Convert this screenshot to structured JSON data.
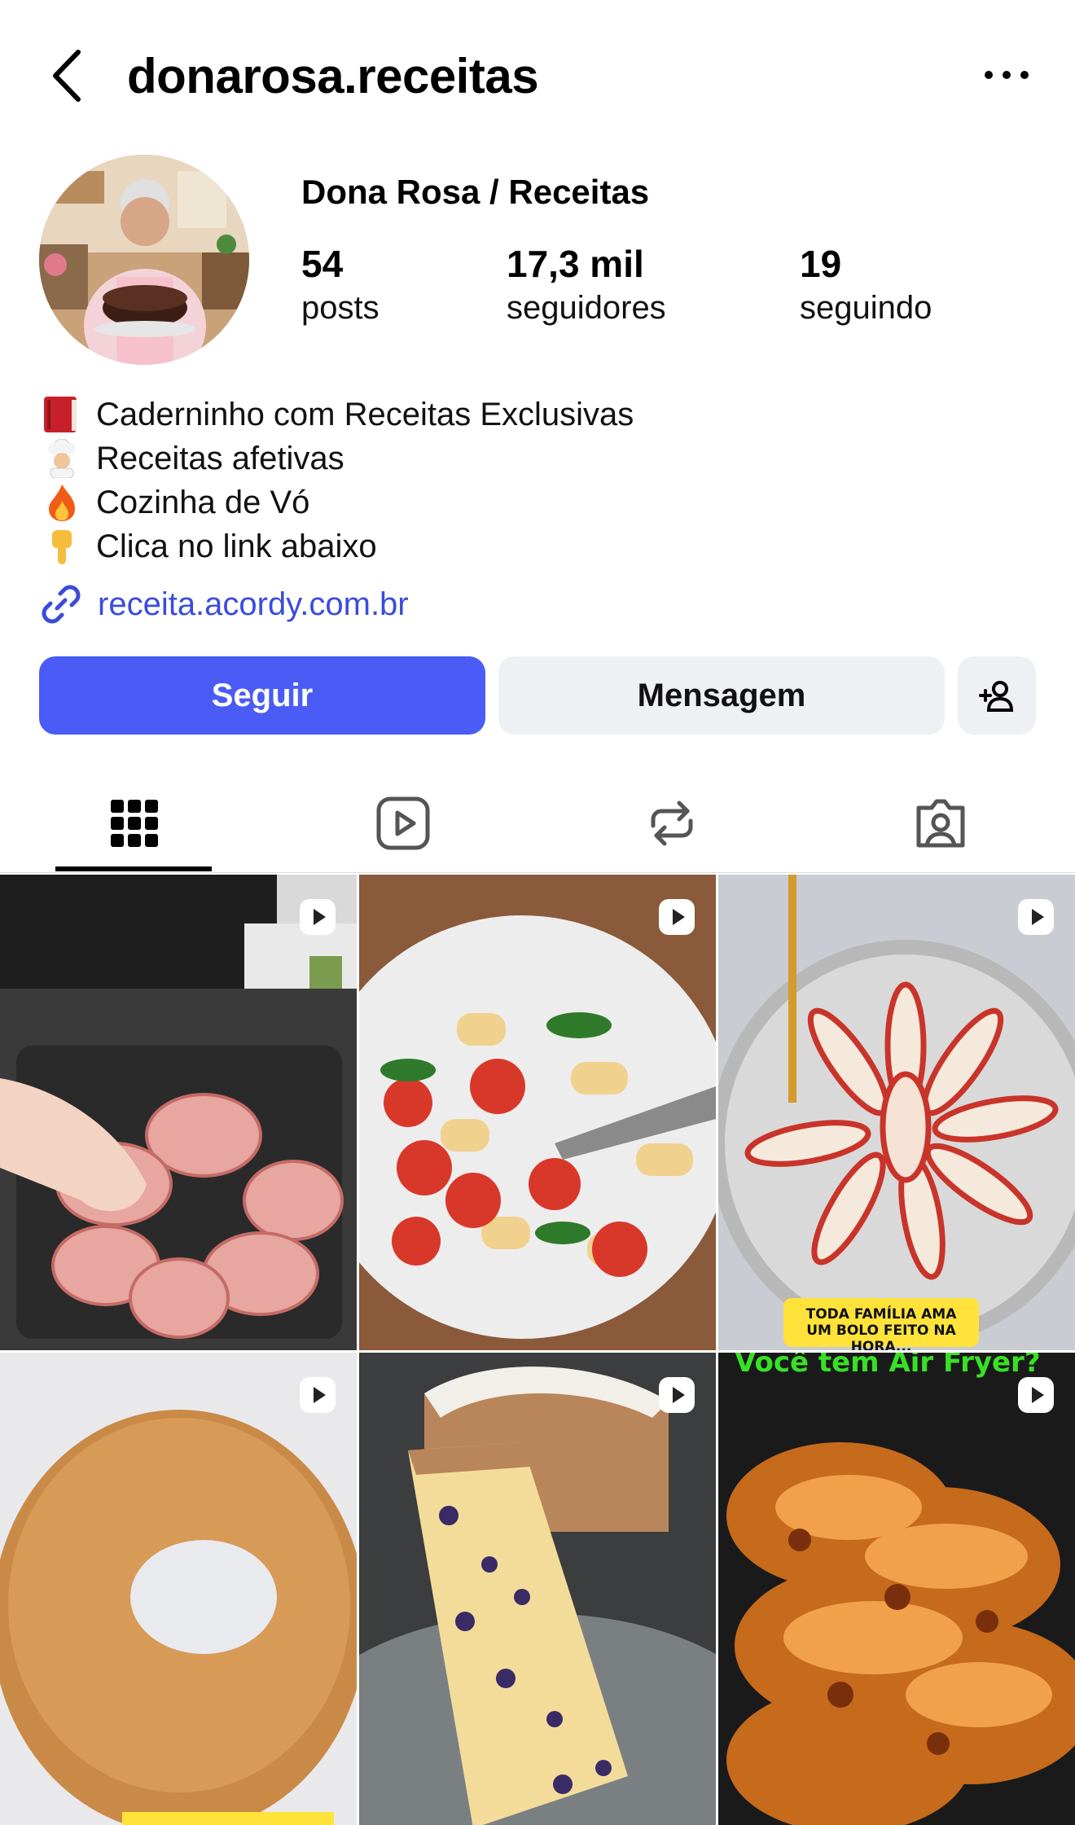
{
  "header": {
    "username": "donarosa.receitas",
    "back_icon": "chevron-left-icon",
    "more_icon": "ellipsis-icon"
  },
  "profile": {
    "display_name": "Dona Rosa / Receitas",
    "stats": [
      {
        "value": "54",
        "label": "posts"
      },
      {
        "value": "17,3 mil",
        "label": "seguidores"
      },
      {
        "value": "19",
        "label": "seguindo"
      }
    ],
    "bio": [
      {
        "emoji": "red-book-icon",
        "text": "Caderninho com Receitas Exclusivas"
      },
      {
        "emoji": "chef-icon",
        "text": "Receitas afetivas"
      },
      {
        "emoji": "fire-icon",
        "text": "Cozinha de Vó"
      },
      {
        "emoji": "pointing-down-icon",
        "text": "Clica no link abaixo"
      }
    ],
    "link": "receita.acordy.com.br"
  },
  "actions": {
    "follow_label": "Seguir",
    "message_label": "Mensagem",
    "suggest_icon": "add-person-icon"
  },
  "tabs": [
    "grid-icon",
    "reels-icon",
    "reposts-icon",
    "tagged-icon"
  ],
  "posts": [
    {
      "subject": "bacon-wrapped chicken in air fryer",
      "caption": ""
    },
    {
      "subject": "pasta with cherry tomatoes",
      "caption": ""
    },
    {
      "subject": "apple cake",
      "caption": "TODA FAMÍLIA AMA UM BOLO FEITO NA HORA..."
    },
    {
      "subject": "ring cake",
      "caption": ""
    },
    {
      "subject": "blueberry cake",
      "caption": ""
    },
    {
      "subject": "glazed chicken in air fryer",
      "caption": "Você tem Air Fryer?"
    }
  ],
  "colors": {
    "follow_button": "#4a5cf5",
    "link": "#3b4cdb",
    "secondary_button": "#eef0f3"
  }
}
